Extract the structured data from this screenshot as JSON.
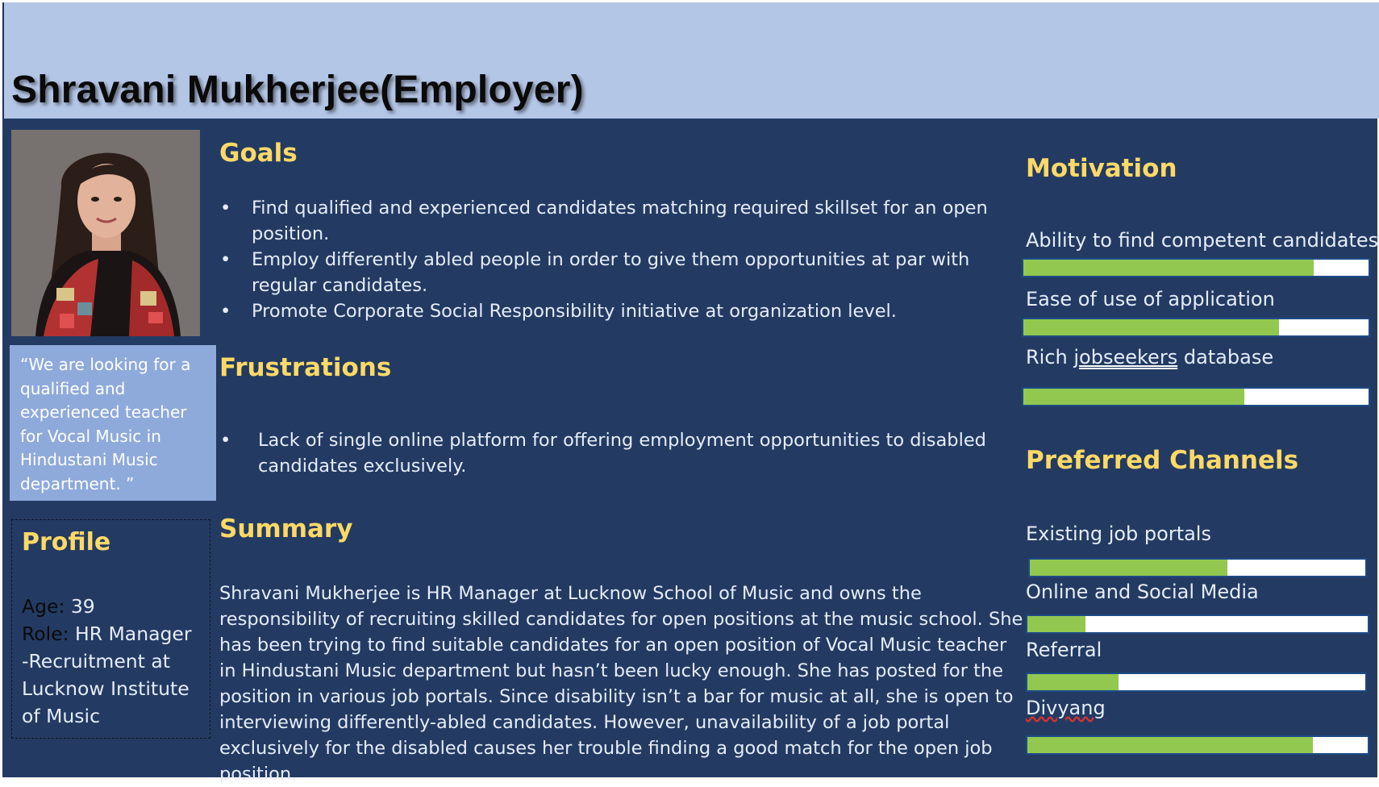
{
  "title": "Shravani Mukherjee(Employer)",
  "quote": "“We are looking for a qualified and experienced teacher for Vocal Music in Hindustani Music department. ”",
  "profile": {
    "heading": "Profile",
    "age_label": "Age:",
    "age_value": "39",
    "role_label": "Role:",
    "role_value_1": "HR Manager",
    "role_value_2": "-Recruitment  at",
    "role_value_3": "Lucknow Institute",
    "role_value_4": "of Music"
  },
  "goals": {
    "heading": "Goals",
    "items": [
      "Find qualified and experienced candidates matching required skillset for an open position.",
      "Employ differently abled people in order to give them opportunities at par with regular candidates.",
      "Promote Corporate Social Responsibility initiative at organization level."
    ]
  },
  "frustrations": {
    "heading": "Frustrations",
    "items": [
      "Lack of single online platform for offering employment opportunities to disabled candidates exclusively."
    ]
  },
  "summary": {
    "heading": "Summary",
    "text": "Shravani Mukherjee is HR Manager at Lucknow School of Music and owns the responsibility of recruiting skilled candidates for open positions at the music school. She has been trying to find suitable candidates for  an open position of Vocal Music teacher in Hindustani Music department but hasn’t been lucky enough. She has posted for the position in various job portals. Since disability isn’t a bar for music at all, she is open to interviewing differently-abled candidates. However, unavailability of a job portal exclusively for the disabled causes her trouble finding a good match for the open job position."
  },
  "motivation": {
    "heading": "Motivation",
    "items": [
      {
        "label": "Ability to find competent candidates",
        "level": 0.84
      },
      {
        "label_pre": "Rich ",
        "label_link": "jobseekers",
        "label_post": " database",
        "level": 0.64
      },
      {
        "label": "Ease of use of application",
        "level": 0.74
      }
    ]
  },
  "channels": {
    "heading": "Preferred Channels",
    "items": [
      {
        "label": "Existing job portals",
        "level": 0.59
      },
      {
        "label": "Online and Social Media",
        "level": 0.17
      },
      {
        "label": "Referral",
        "level": 0.27
      },
      {
        "label": "Divyang",
        "level": 0.84
      }
    ]
  },
  "colors": {
    "header_bg": "#b4c6e6",
    "panel_bg": "#233b63",
    "heading": "#ffd966",
    "quote_bg": "#8eaadb",
    "bar_fill": "#92c84f"
  }
}
